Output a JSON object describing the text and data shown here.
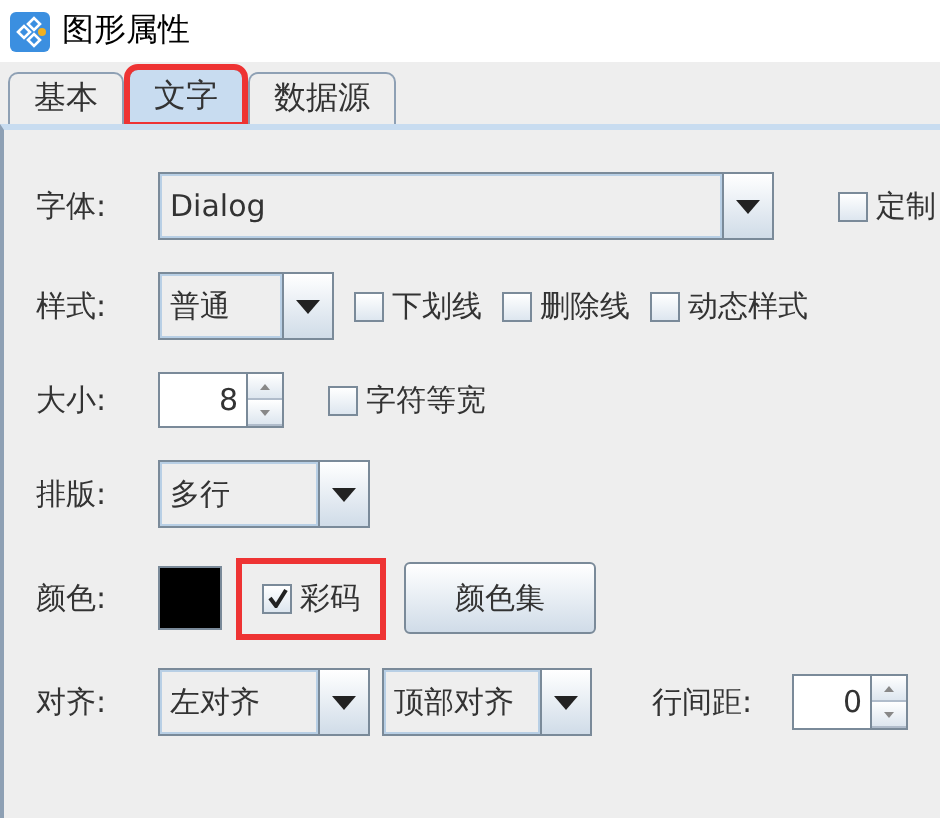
{
  "window": {
    "title": "图形属性"
  },
  "tabs": [
    {
      "label": "基本",
      "selected": false,
      "highlighted": false
    },
    {
      "label": "文字",
      "selected": true,
      "highlighted": true
    },
    {
      "label": "数据源",
      "selected": false,
      "highlighted": false
    }
  ],
  "font": {
    "label": "字体:",
    "value": "Dialog",
    "custom": {
      "label": "定制",
      "checked": false
    }
  },
  "style": {
    "label": "样式:",
    "value": "普通",
    "options": [
      {
        "label": "下划线",
        "checked": false
      },
      {
        "label": "删除线",
        "checked": false
      },
      {
        "label": "动态样式",
        "checked": false
      }
    ]
  },
  "size": {
    "label": "大小:",
    "value": "8",
    "monospace": {
      "label": "字符等宽",
      "checked": false
    }
  },
  "layout": {
    "label": "排版:",
    "value": "多行"
  },
  "color": {
    "label": "颜色:",
    "color": "#000000",
    "color_code": {
      "label": "彩码",
      "checked": true,
      "highlighted": true
    },
    "button": "颜色集"
  },
  "align": {
    "label": "对齐:",
    "horizontal": "左对齐",
    "vertical": "顶部对齐",
    "spacing_label": "行间距:",
    "spacing": "0"
  }
}
